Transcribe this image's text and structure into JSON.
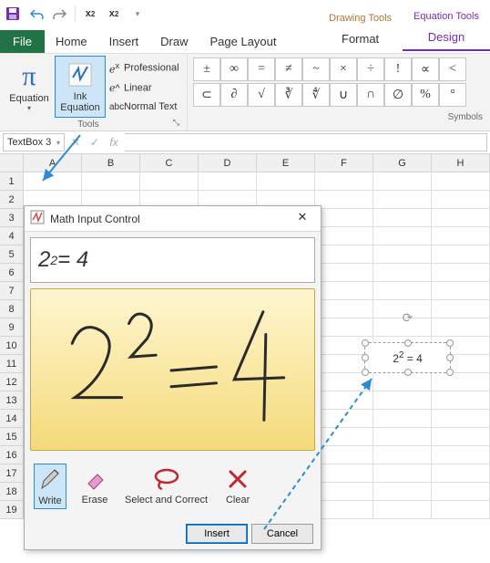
{
  "qat": {
    "items": [
      "save",
      "undo",
      "redo",
      "subscript",
      "superscript"
    ]
  },
  "tabs": {
    "file": "File",
    "home": "Home",
    "insert": "Insert",
    "draw": "Draw",
    "page_layout": "Page Layout"
  },
  "ctx": {
    "drawing_title": "Drawing Tools",
    "equation_title": "Equation Tools",
    "format": "Format",
    "design": "Design"
  },
  "ribbon": {
    "equation": "Equation",
    "ink_equation": "Ink\nEquation",
    "tools_label": "Tools",
    "professional": "Professional",
    "linear": "Linear",
    "normal_text": "Normal Text",
    "symbols_label": "Symbols",
    "sym_row1": [
      "±",
      "∞",
      "=",
      "≠",
      "~",
      "×",
      "÷",
      "!",
      "∝",
      "<"
    ],
    "sym_row2": [
      "⊂",
      "∂",
      "√",
      "∛",
      "∜",
      "∪",
      "∩",
      "∅",
      "%",
      "°"
    ]
  },
  "fbar": {
    "name": "TextBox 3",
    "fx": "fx"
  },
  "grid": {
    "cols": [
      "A",
      "B",
      "C",
      "D",
      "E",
      "F",
      "G",
      "H"
    ],
    "rows": 19
  },
  "textbox": {
    "eq_base1": "2",
    "eq_sup": "2",
    "eq_rest": " = 4"
  },
  "dialog": {
    "title": "Math Input Control",
    "preview_base": "2",
    "preview_sup": "2",
    "preview_rest": " = 4",
    "write": "Write",
    "erase": "Erase",
    "select": "Select and Correct",
    "clear": "Clear",
    "insert": "Insert",
    "cancel": "Cancel"
  }
}
